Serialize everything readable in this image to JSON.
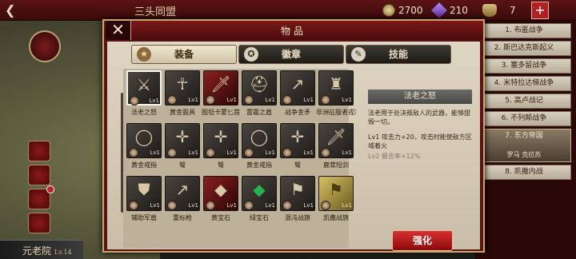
{
  "topbar": {
    "title": "三头同盟",
    "gold": "2700",
    "gems": "210",
    "tokens": "7",
    "icons": {
      "back": "back-arrow-icon",
      "gold": "coin-icon",
      "gems": "gem-icon",
      "tokens": "mask-icon",
      "add": "plus-icon"
    }
  },
  "bottom": {
    "name": "元老院",
    "level": "Lv.14"
  },
  "panel": {
    "title": "物品",
    "tabs": [
      {
        "label": "装备",
        "active": true,
        "icon": "helmet-icon"
      },
      {
        "label": "徽章",
        "active": false,
        "icon": "badge-icon"
      },
      {
        "label": "技能",
        "active": false,
        "icon": "scroll-icon"
      }
    ],
    "items": [
      {
        "name": "法老之怒",
        "level": "Lv1",
        "selected": true
      },
      {
        "name": "黄金面具",
        "level": "Lv1"
      },
      {
        "name": "图坦卡蒙匕首",
        "level": "Lv1"
      },
      {
        "name": "雷霆之盾",
        "level": "Lv1"
      },
      {
        "name": "战争金矛",
        "level": "Lv1"
      },
      {
        "name": "非洲征服者戎装",
        "level": "Lv1"
      },
      {
        "name": "黄金戒指",
        "level": "Lv1"
      },
      {
        "name": "弩",
        "level": "Lv1"
      },
      {
        "name": "弩",
        "level": "Lv1"
      },
      {
        "name": "黄金戒指",
        "level": "Lv1"
      },
      {
        "name": "弩",
        "level": "Lv1"
      },
      {
        "name": "鹿茸短剑",
        "level": "Lv1"
      },
      {
        "name": "辅助军盾",
        "level": "Lv1"
      },
      {
        "name": "重标枪",
        "level": "Lv1"
      },
      {
        "name": "黄宝石",
        "level": "Lv1"
      },
      {
        "name": "绿宝石",
        "level": "Lv1"
      },
      {
        "name": "混沌战旗",
        "level": "Lv1"
      },
      {
        "name": "凯撒战旗",
        "level": "Lv1"
      }
    ],
    "detail": {
      "title": "法老之怒",
      "description": "法老用于处决叛敌人的武器，能够甜毁一切。",
      "line1": "Lv1  攻击力+20，攻击时能使敌方区域着火",
      "line2": "Lv2  暴击率+12%"
    },
    "enhance_label": "强化"
  },
  "chapters": [
    {
      "label": "1. 布匿战争"
    },
    {
      "label": "2. 斯巴达克斯起义"
    },
    {
      "label": "3. 塞多留战争"
    },
    {
      "label": "4. 米特拉达梯战争"
    },
    {
      "label": "5. 高卢战记"
    },
    {
      "label": "6. 不列颠战争"
    },
    {
      "label": "7. 东方帝国",
      "sub": "罗马  克拉苏"
    },
    {
      "label": "8. 凯撒内战"
    }
  ]
}
